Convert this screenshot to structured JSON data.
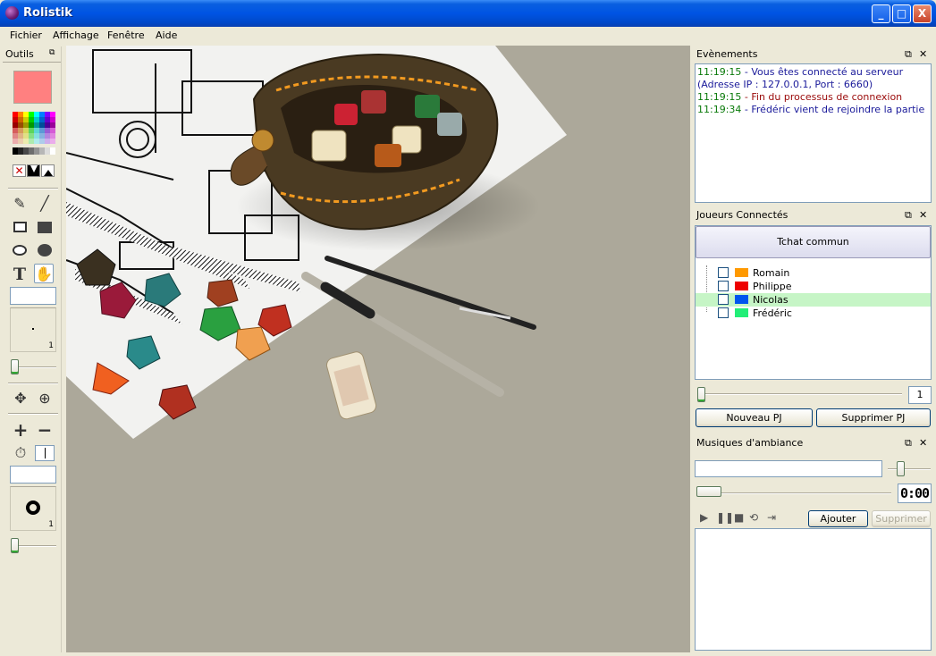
{
  "window": {
    "title": "Rolistik",
    "controls": {
      "minimize": "_",
      "maximize": "□",
      "close": "X"
    }
  },
  "menu": [
    "Fichier",
    "Affichage",
    "Fenêtre",
    "Aide"
  ],
  "tools": {
    "title": "Outils",
    "current_color": "#ff8080",
    "pen_size_value": "1",
    "pnj_size_value": "1"
  },
  "events": {
    "title": "Evènements",
    "lines": [
      {
        "time": "11:19:15",
        "sep": " - ",
        "text": "Vous êtes connecté au serveur (Adresse IP : 127.0.0.1, Port : 6660)"
      },
      {
        "time": "11:19:15",
        "sep": " - ",
        "text": "Fin du processus de connexion"
      },
      {
        "time": "11:19:34",
        "sep": " - ",
        "text": "Frédéric vient de rejoindre la partie"
      }
    ]
  },
  "players": {
    "title": "Joueurs Connectés",
    "chat_button": "Tchat commun",
    "list": [
      {
        "name": "Romain",
        "color": "#ff9900"
      },
      {
        "name": "Philippe",
        "color": "#ee0000"
      },
      {
        "name": "Nicolas",
        "color": "#0055ee"
      },
      {
        "name": "Frédéric",
        "color": "#22ee77"
      }
    ],
    "size_value": "1",
    "new_pc_button": "Nouveau PJ",
    "delete_pc_button": "Supprimer PJ"
  },
  "music": {
    "title": "Musiques d'ambiance",
    "time_display": "0:00",
    "add_button": "Ajouter",
    "delete_button": "Supprimer"
  },
  "colors": {
    "titlebar": "#0054e3",
    "workspace": "#aca89a",
    "selection": "#c6f5c6"
  }
}
